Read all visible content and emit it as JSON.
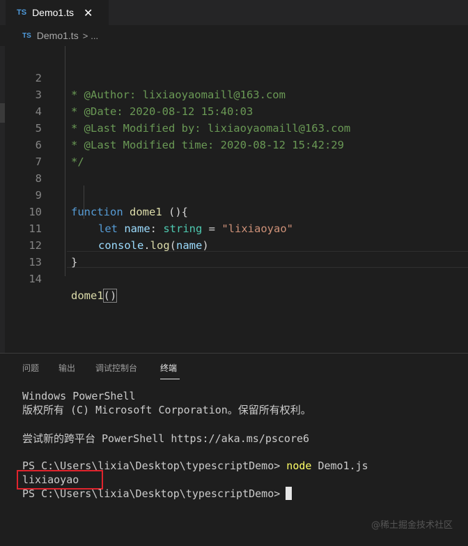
{
  "tab": {
    "badge": "TS",
    "title": "Demo1.ts",
    "close_glyph": "✕"
  },
  "breadcrumb": {
    "badge": "TS",
    "file": "Demo1.ts",
    "separator": ">",
    "more": "..."
  },
  "editor": {
    "lines": [
      {
        "num": "2",
        "text": "* @Author: lixiaoyaomaill@163.com"
      },
      {
        "num": "3",
        "text": "* @Date: 2020-08-12 15:40:03"
      },
      {
        "num": "4",
        "text": "* @Last Modified by: lixiaoyaomaill@163.com"
      },
      {
        "num": "5",
        "text": "* @Last Modified time: 2020-08-12 15:42:29"
      },
      {
        "num": "6",
        "text": "*/"
      },
      {
        "num": "7",
        "text": ""
      },
      {
        "num": "8",
        "text": ""
      },
      {
        "num": "9",
        "text": "function dome1 (){"
      },
      {
        "num": "10",
        "text": "let name: string = \"lixiaoyao\""
      },
      {
        "num": "11",
        "text": "console.log(name)"
      },
      {
        "num": "12",
        "text": "}"
      },
      {
        "num": "13",
        "text": ""
      },
      {
        "num": "14",
        "text": "dome1()"
      }
    ],
    "tokens": {
      "kw_function": "function",
      "fn_dome1": "dome1",
      "sig_rest": " (){",
      "kw_let": "let",
      "var_name": "name",
      "colon": ": ",
      "type_string": "string",
      "eq": " = ",
      "str_val": "\"lixiaoyao\"",
      "obj_console": "console",
      "dot": ".",
      "fn_log": "log",
      "paren_open": "(",
      "arg_name": "name",
      "paren_close": ")",
      "close_brace": "}",
      "call_fn": "dome1",
      "call_parens": "()"
    }
  },
  "panel": {
    "tabs": [
      "问题",
      "输出",
      "调试控制台",
      "终端"
    ],
    "active_tab": "终端"
  },
  "terminal": {
    "line1": "Windows PowerShell",
    "line2": "版权所有 (C) Microsoft Corporation。保留所有权利。",
    "line3": "尝试新的跨平台 PowerShell https://aka.ms/pscore6",
    "prompt1": "PS C:\\Users\\lixia\\Desktop\\typescriptDemo> ",
    "cmd_node": "node",
    "cmd_arg": " Demo1.js",
    "output": "lixiaoyao",
    "prompt2": "PS C:\\Users\\lixia\\Desktop\\typescriptDemo>"
  },
  "watermark": "@稀土掘金技术社区",
  "colors": {
    "background": "#1e1e1e",
    "comment": "#6a9955",
    "keyword": "#569cd6",
    "function": "#dcdcaa",
    "variable": "#9cdcfe",
    "type": "#4ec9b0",
    "string": "#ce9178",
    "highlight_box": "#e0242d"
  }
}
